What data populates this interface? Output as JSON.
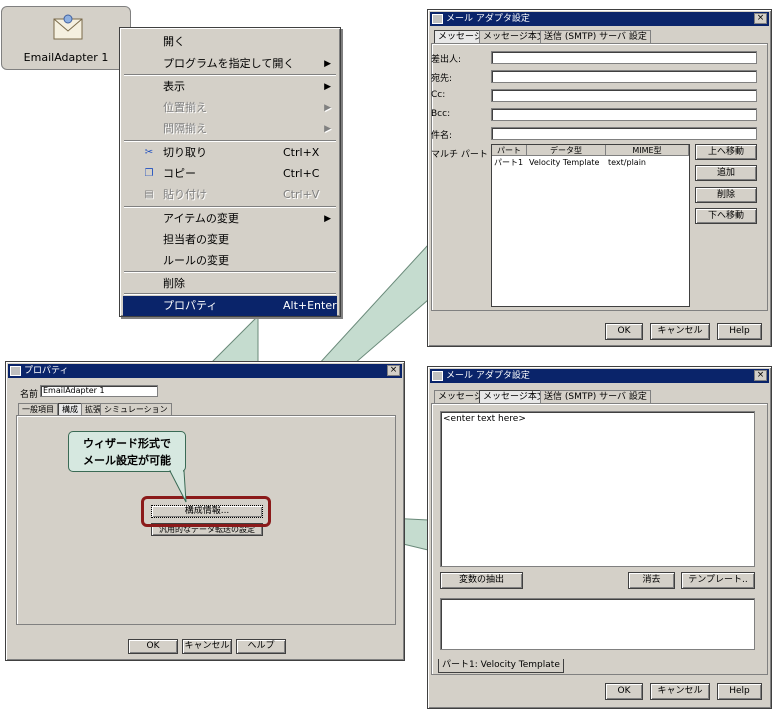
{
  "desktop_icon": {
    "label": "EmailAdapter 1"
  },
  "context_menu": {
    "items": [
      {
        "label": "開く",
        "shortcut": "",
        "submenu": false,
        "disabled": false,
        "icon": ""
      },
      {
        "label": "プログラムを指定して開く",
        "shortcut": "",
        "submenu": true,
        "disabled": false,
        "icon": ""
      },
      {
        "label": "表示",
        "shortcut": "",
        "submenu": true,
        "disabled": false,
        "icon": ""
      },
      {
        "label": "位置揃え",
        "shortcut": "",
        "submenu": true,
        "disabled": true,
        "icon": ""
      },
      {
        "label": "間隔揃え",
        "shortcut": "",
        "submenu": true,
        "disabled": true,
        "icon": ""
      },
      {
        "label": "切り取り",
        "shortcut": "Ctrl+X",
        "submenu": false,
        "disabled": false,
        "icon": "scissors-icon"
      },
      {
        "label": "コピー",
        "shortcut": "Ctrl+C",
        "submenu": false,
        "disabled": false,
        "icon": "copy-icon"
      },
      {
        "label": "貼り付け",
        "shortcut": "Ctrl+V",
        "submenu": false,
        "disabled": true,
        "icon": "paste-icon"
      },
      {
        "label": "アイテムの変更",
        "shortcut": "",
        "submenu": true,
        "disabled": false,
        "icon": ""
      },
      {
        "label": "担当者の変更",
        "shortcut": "",
        "submenu": false,
        "disabled": false,
        "icon": ""
      },
      {
        "label": "ルールの変更",
        "shortcut": "",
        "submenu": false,
        "disabled": false,
        "icon": ""
      },
      {
        "label": "削除",
        "shortcut": "",
        "submenu": false,
        "disabled": false,
        "icon": ""
      },
      {
        "label": "プロパティ",
        "shortcut": "Alt+Enter",
        "submenu": false,
        "disabled": false,
        "icon": "",
        "highlighted": true
      }
    ]
  },
  "props_window": {
    "title": "プロパティ",
    "name_label": "名前",
    "name_value": "EmailAdapter 1",
    "tabs": [
      "一般項目",
      "構成",
      "拡張",
      "シミュレーション"
    ],
    "selected_tab": "構成",
    "config_button": "構成情報...",
    "generic_button": "汎用的なデータ転送の設定",
    "ok": "OK",
    "cancel": "キャンセル",
    "help": "ヘルプ"
  },
  "callout": {
    "line1": "ウィザード形式で",
    "line2": "メール設定が可能"
  },
  "mail_top": {
    "title": "メール アダプタ設定",
    "tabs": [
      "メッセージ",
      "メッセージ本文",
      "送信 (SMTP) サーバ 設定"
    ],
    "selected_tab": "メッセージ",
    "fields": [
      "差出人:",
      "宛先:",
      "Cc:",
      "Bcc:",
      "件名:"
    ],
    "multipart_label": "マルチ パート",
    "columns": [
      "パート",
      "データ型",
      "MIME型"
    ],
    "rows": [
      [
        "パート1",
        "Velocity Template",
        "text/plain"
      ]
    ],
    "buttons": [
      "上へ移動",
      "追加",
      "削除",
      "下へ移動"
    ],
    "ok": "OK",
    "cancel": "キャンセル",
    "help": "Help"
  },
  "mail_bottom": {
    "title": "メール アダプタ設定",
    "tabs": [
      "メッセージ",
      "メッセージ本文",
      "送信 (SMTP) サーバ 設定"
    ],
    "selected_tab": "メッセージ本文",
    "body_text": "<enter text here>",
    "extract_button": "変数の抽出",
    "clear_button": "消去",
    "template_button": "テンプレート..",
    "part_tab": "パート1: Velocity Template",
    "ok": "OK",
    "cancel": "キャンセル",
    "help": "Help"
  }
}
